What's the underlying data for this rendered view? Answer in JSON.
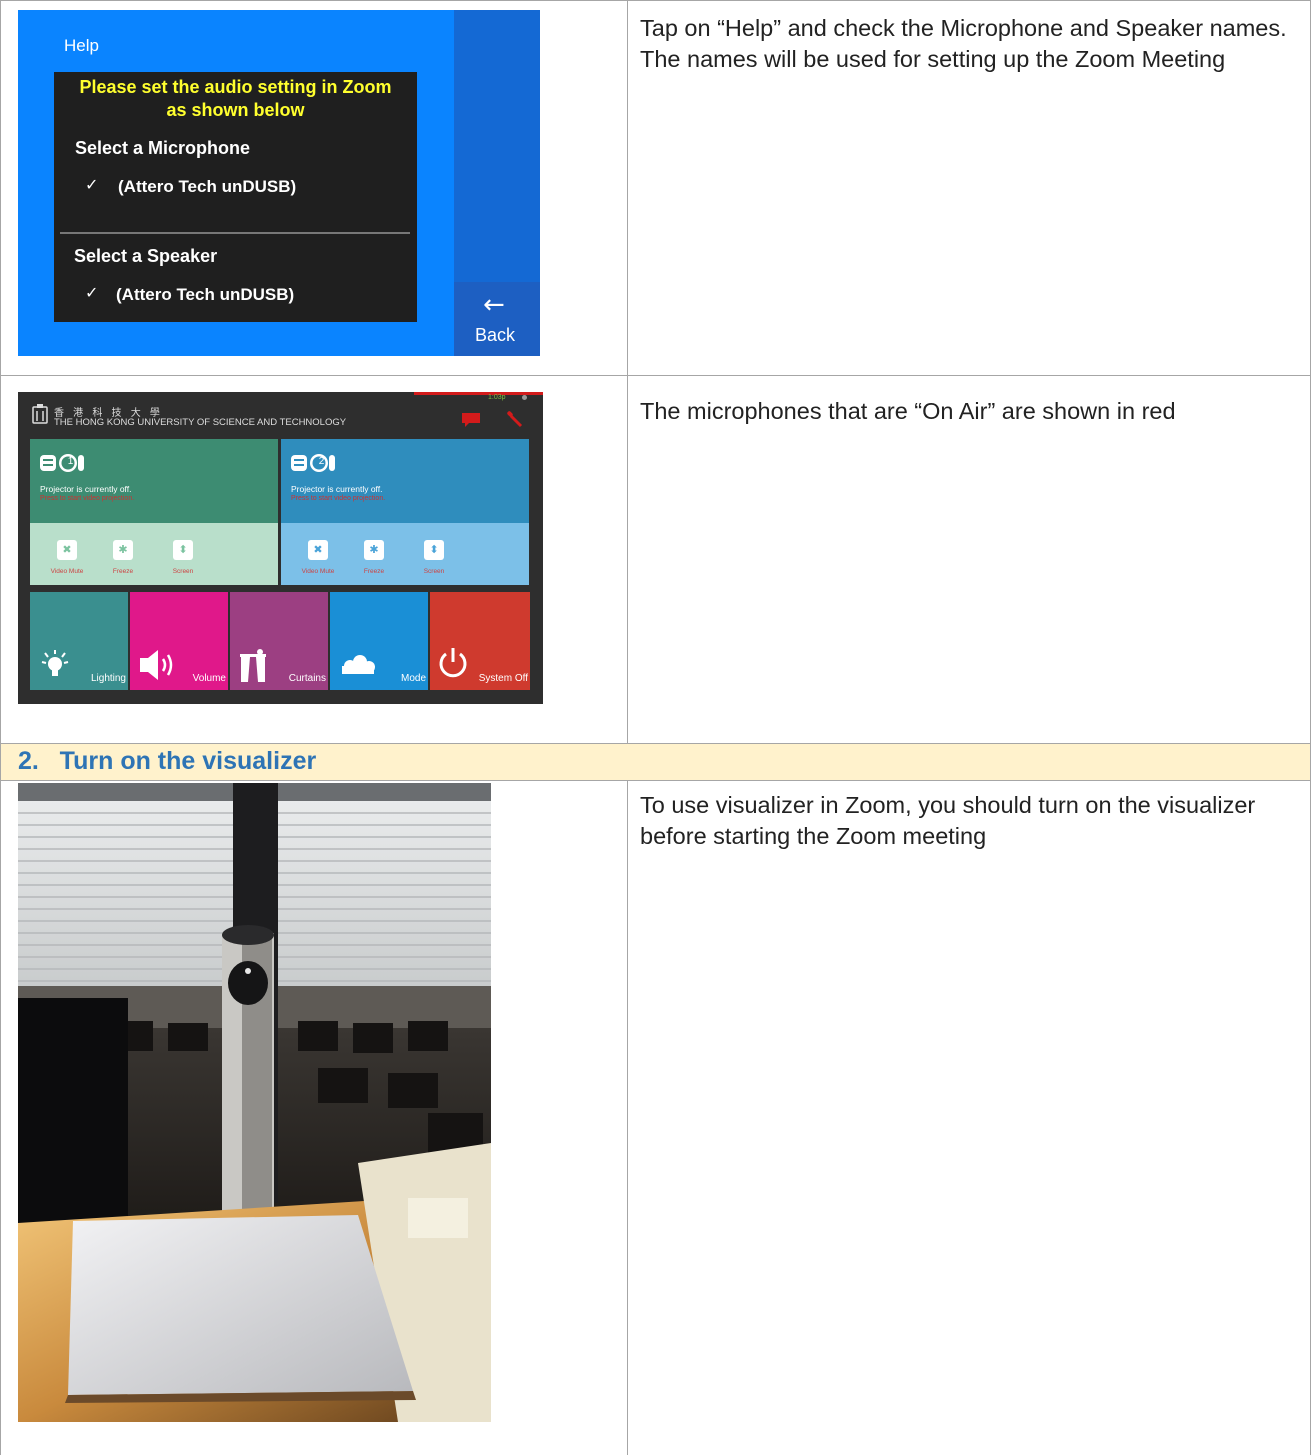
{
  "rows": [
    {
      "description": "Tap on “Help” and check the Microphone and Speaker names. The names will be used for setting up the Zoom Meeting"
    },
    {
      "description": "The microphones that are “On Air” are shown in red"
    },
    {
      "description": "To use visualizer in Zoom, you should turn on the visualizer before starting the Zoom meeting"
    }
  ],
  "section": {
    "title": "2.   Turn on the visualizer"
  },
  "help_screen": {
    "title": "Help",
    "heading_line1": "Please set the audio setting in Zoom",
    "heading_line2": "as shown below",
    "mic_label": "Select a Microphone",
    "mic_device": "(Attero Tech unDUSB)",
    "speaker_label": "Select a Speaker",
    "speaker_device": "(Attero Tech unDUSB)",
    "check_glyph": "✓",
    "back_arrow": "←",
    "back_label": "Back"
  },
  "control_panel": {
    "university_zh": "香 港 科 技 大 學",
    "university_en": "THE HONG KONG UNIVERSITY OF SCIENCE AND TECHNOLOGY",
    "status_text": "1:03p",
    "projectors": [
      {
        "number": "1",
        "status": "Projector is currently off.",
        "hint": "Press to start video projection.",
        "buttons": [
          "Video Mute",
          "Freeze",
          "Screen"
        ]
      },
      {
        "number": "2",
        "status": "Projector is currently off.",
        "hint": "Press to start video projection.",
        "buttons": [
          "Video Mute",
          "Freeze",
          "Screen"
        ]
      }
    ],
    "tiles": [
      {
        "label": "Lighting",
        "color": "#3a8f8f"
      },
      {
        "label": "Volume",
        "color": "#e0188a"
      },
      {
        "label": "Curtains",
        "color": "#9c3f82"
      },
      {
        "label": "Mode",
        "color": "#1a8fd6"
      },
      {
        "label": "System Off",
        "color": "#cf3a2e"
      }
    ]
  },
  "colors": {
    "section_bg": "#fff2cc",
    "section_text": "#2e74b5",
    "help_blue": "#0a84ff",
    "help_yellow": "#ffff2e",
    "proj1_top": "#3d8c72",
    "proj1_bottom": "#b9dfcb",
    "proj2_top": "#2f8dbd",
    "proj2_bottom": "#7cc0e8"
  }
}
